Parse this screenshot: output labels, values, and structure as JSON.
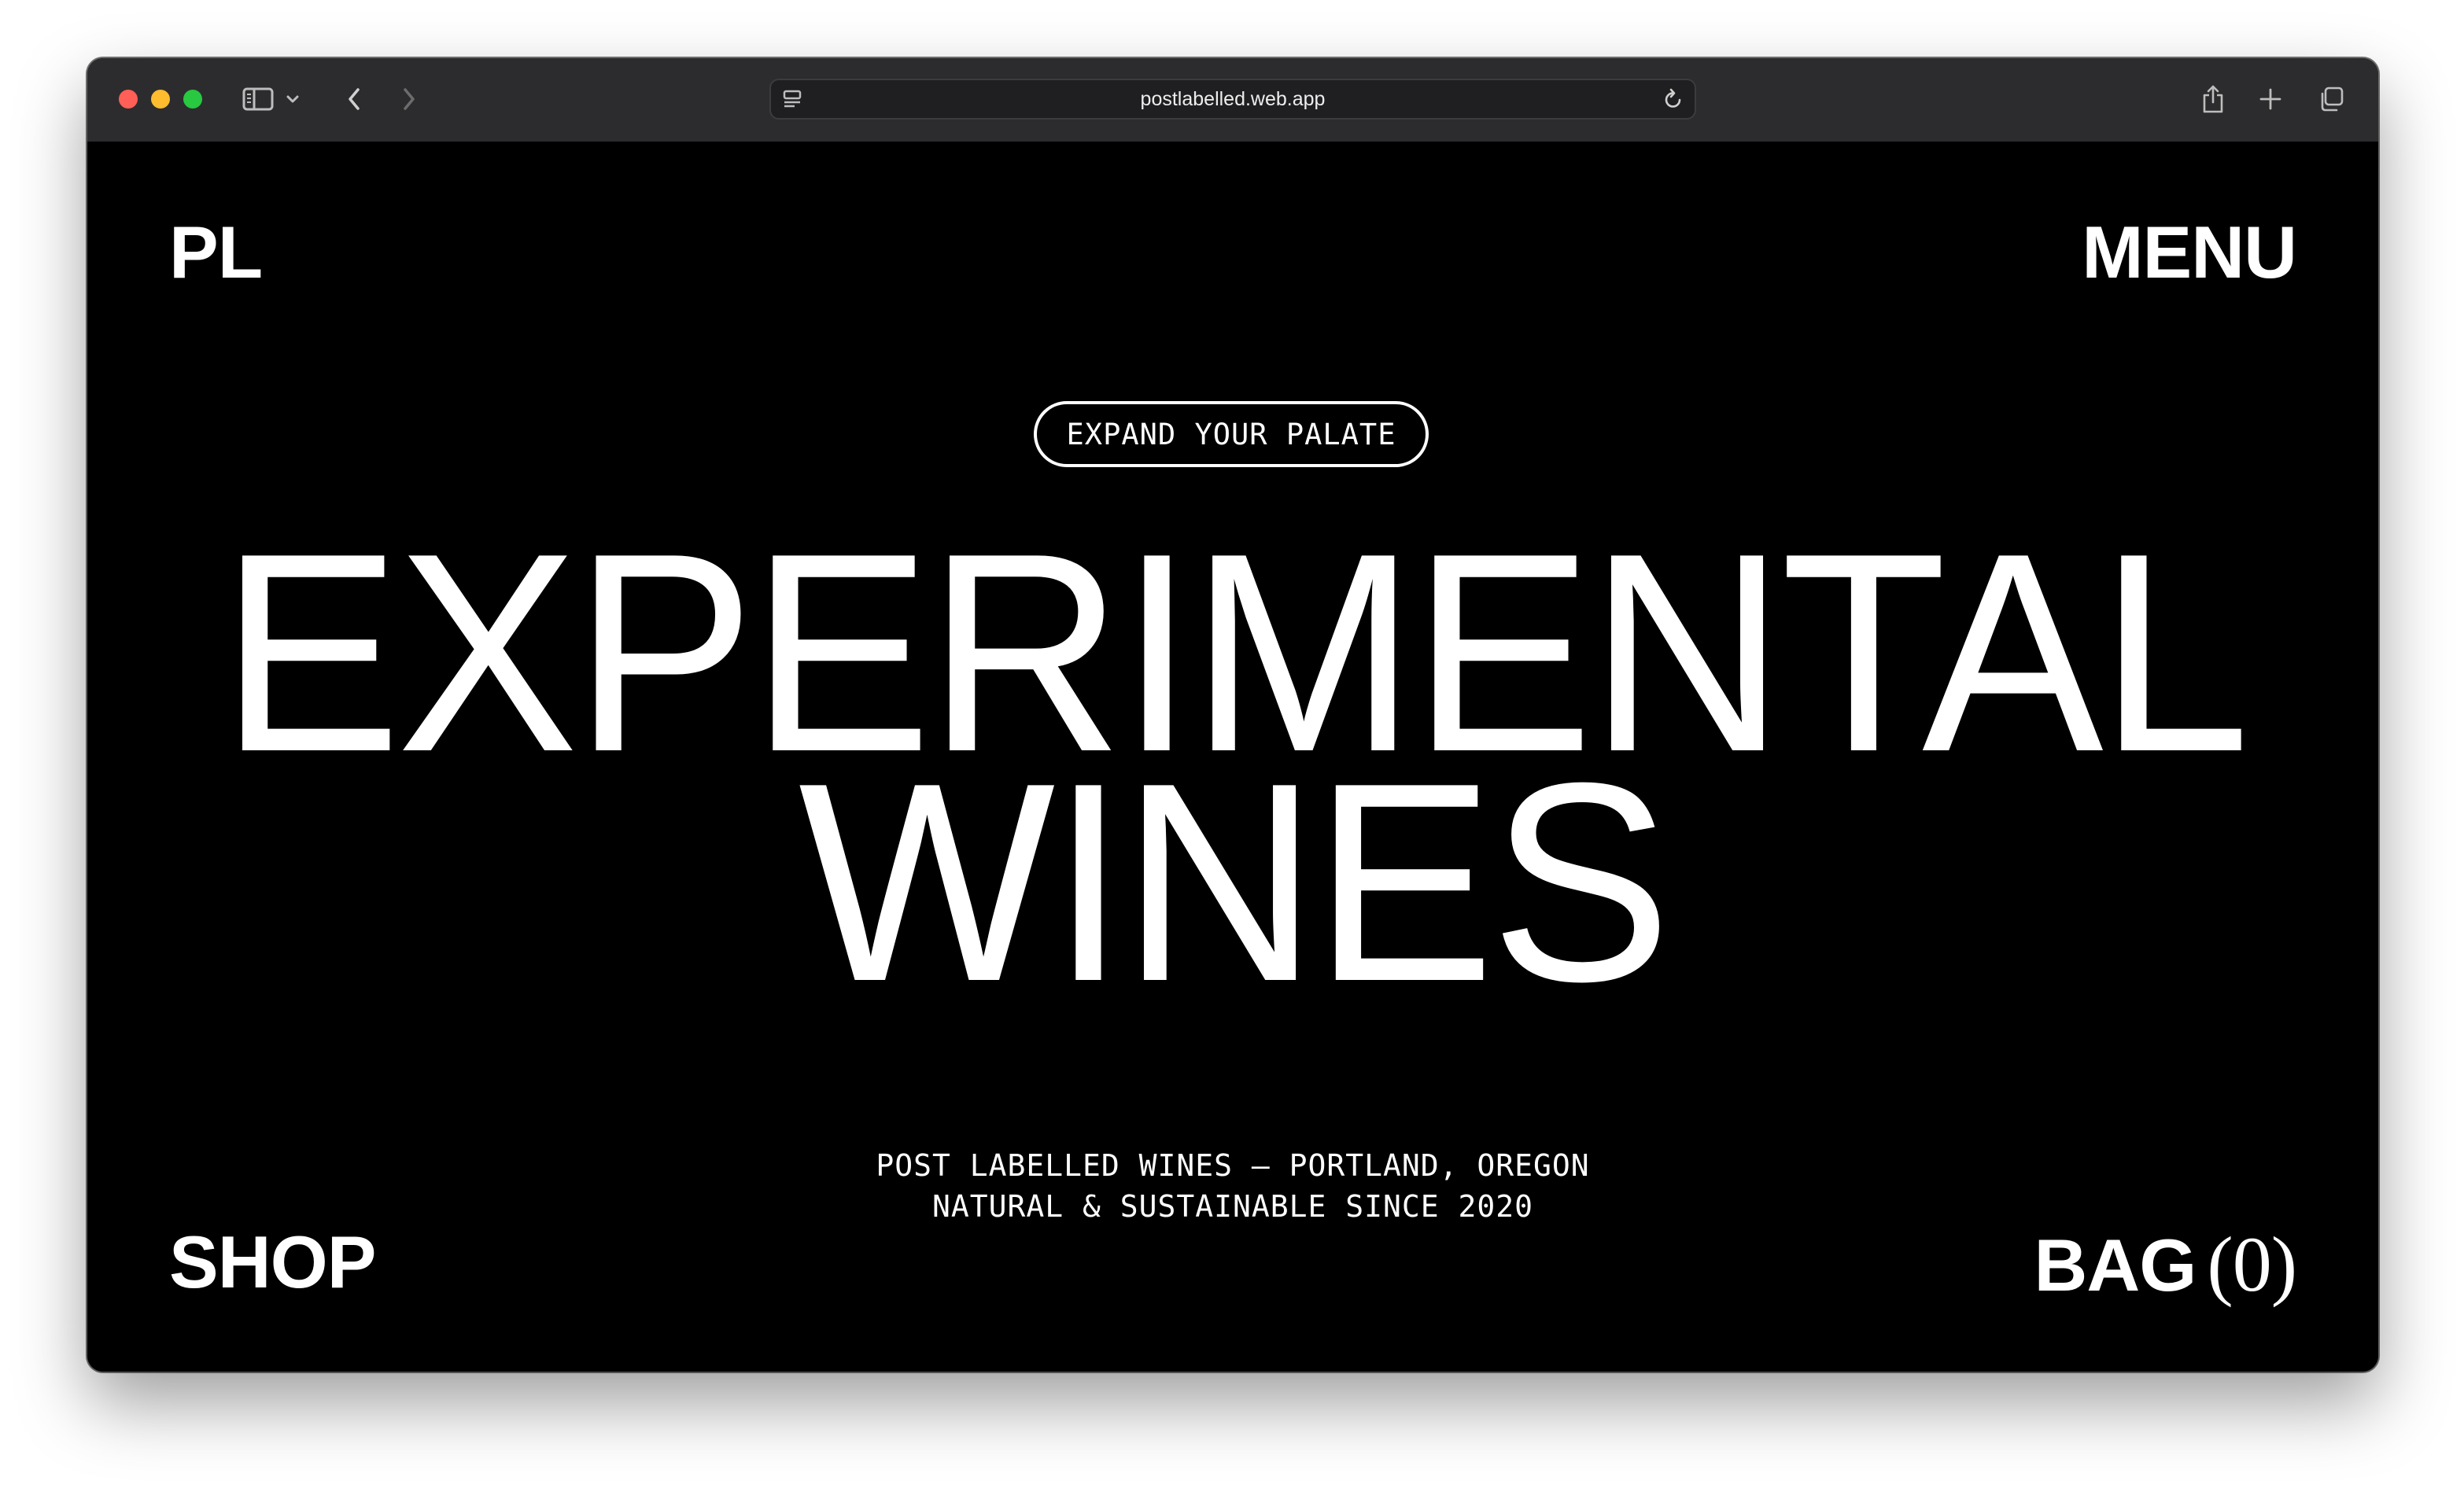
{
  "browser": {
    "url": "postlabelled.web.app"
  },
  "icons": {
    "sidebar": "sidebar-icon",
    "back": "chevron-left-icon",
    "forward": "chevron-right-icon",
    "reader": "reader-icon",
    "reload": "reload-icon",
    "share": "share-icon",
    "new_tab": "plus-icon",
    "tabs": "tabs-overview-icon"
  },
  "site": {
    "logo": "PL",
    "menu_label": "MENU",
    "tagline_pill": "EXPAND YOUR PALATE",
    "headline_line1": "EXPERIMENTAL",
    "headline_line2": "WINES",
    "subtitle_line1": "POST LABELLED WINES — PORTLAND, OREGON",
    "subtitle_line2": "NATURAL & SUSTAINABLE SINCE 2020",
    "shop_label": "SHOP",
    "bag_label": "BAG",
    "bag_count": "(0)"
  },
  "colors": {
    "background": "#000000",
    "foreground": "#ffffff",
    "titlebar": "#2c2c2e"
  }
}
